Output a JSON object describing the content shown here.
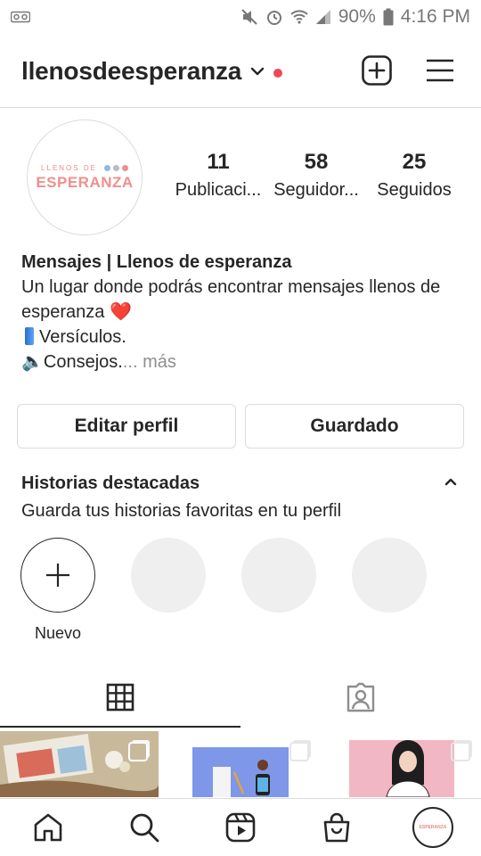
{
  "status_bar": {
    "battery": "90%",
    "time": "4:16 PM",
    "icons": [
      "voicemail-icon",
      "mute-icon",
      "alarm-icon",
      "wifi-icon",
      "signal-icon",
      "battery-icon"
    ]
  },
  "header": {
    "username": "llenosdeesperanza",
    "icons": [
      "chevron-down-icon",
      "notification-dot",
      "new-post-icon",
      "menu-icon"
    ]
  },
  "profile": {
    "avatar_logo_top": "LLENOS DE",
    "avatar_logo_main": "ESPERANZA",
    "logo_dot_colors": [
      "#8fb8e6",
      "#b9b9c9",
      "#ef8f8f"
    ],
    "stats": [
      {
        "value": "11",
        "label": "Publicaci..."
      },
      {
        "value": "58",
        "label": "Seguidor..."
      },
      {
        "value": "25",
        "label": "Seguidos"
      }
    ]
  },
  "bio": {
    "name": "Mensajes | Llenos de esperanza",
    "line1": "Un lugar donde podrás encontrar mensajes llenos de",
    "line2": "esperanza ❤️",
    "line3": "Versículos.",
    "line4": "🔈Consejos.",
    "more": "... más"
  },
  "buttons": {
    "edit": "Editar perfil",
    "saved": "Guardado"
  },
  "highlights": {
    "title": "Historias destacadas",
    "subtitle": "Guarda tus historias favoritas en tu perfil",
    "new_label": "Nuevo"
  },
  "tabs": [
    "grid-icon",
    "tagged-icon"
  ],
  "bottom_nav": [
    "home-icon",
    "search-icon",
    "reels-icon",
    "shop-icon",
    "profile-avatar"
  ],
  "colors": {
    "accent_red": "#ed4956",
    "text": "#262626",
    "muted": "#8e8e8e",
    "border": "#dbdbdb"
  }
}
